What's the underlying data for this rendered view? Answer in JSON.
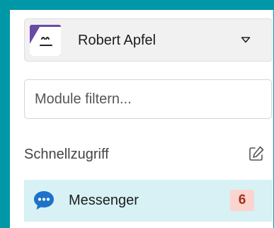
{
  "account": {
    "name": "Robert Apfel",
    "avatar_icon": "sleeping-face-avatar",
    "dropdown_icon": "chevron-down-icon"
  },
  "filter": {
    "placeholder": "Module filtern...",
    "value": ""
  },
  "quick_access": {
    "title": "Schnellzugriff",
    "edit_icon": "edit-icon"
  },
  "items": [
    {
      "label": "Messenger",
      "icon": "chat-bubble-icon",
      "badge": "6"
    }
  ],
  "colors": {
    "frame": "#0097a7",
    "avatar": "#6a4aa6",
    "item_highlight": "#d7f1f5",
    "chat_icon": "#1e72c8",
    "badge_bg": "#fbd4cf",
    "badge_text": "#a3321c"
  }
}
